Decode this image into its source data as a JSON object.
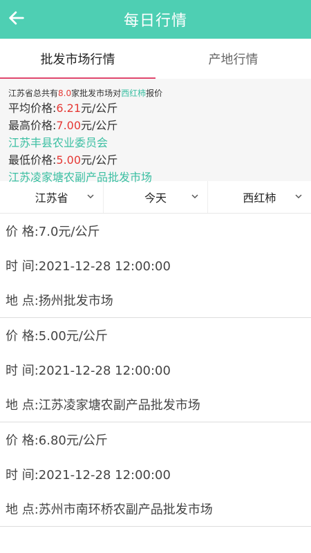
{
  "header": {
    "title": "每日行情"
  },
  "tabs": [
    {
      "label": "批发市场行情"
    },
    {
      "label": "产地行情"
    }
  ],
  "summary": {
    "intro_prefix": "江苏省总共有",
    "count": "8.0",
    "intro_mid": "家批发市场对",
    "product": "西红柿",
    "intro_suffix": "报价",
    "avg_label": "平均价格:",
    "avg_value": "6.21",
    "max_label": "最高价格:",
    "max_value": "7.00",
    "max_market": "江苏丰县农业委员会",
    "min_label": "最低价格:",
    "min_value": "5.00",
    "min_market": "江苏凌家塘农副产品批发市场",
    "unit": "元/公斤"
  },
  "filters": [
    {
      "label": "江苏省"
    },
    {
      "label": "今天"
    },
    {
      "label": "西红柿"
    }
  ],
  "listings": [
    {
      "price": "价 格:7.0元/公斤",
      "time": "时 间:2021-12-28 12:00:00",
      "place": "地 点:扬州批发市场"
    },
    {
      "price": "价 格:5.00元/公斤",
      "time": "时 间:2021-12-28 12:00:00",
      "place": "地 点:江苏凌家塘农副产品批发市场"
    },
    {
      "price": "价 格:6.80元/公斤",
      "time": "时 间:2021-12-28 12:00:00",
      "place": "地 点:苏州市南环桥农副产品批发市场"
    }
  ],
  "colors": {
    "header": "#4ecfb3",
    "accent_red": "#e53935",
    "accent_teal": "#3bbfa2",
    "tab_indicator": "#e0466d"
  },
  "icons": {
    "back": "arrow-left-icon",
    "dropdown": "chevron-down-icon"
  }
}
